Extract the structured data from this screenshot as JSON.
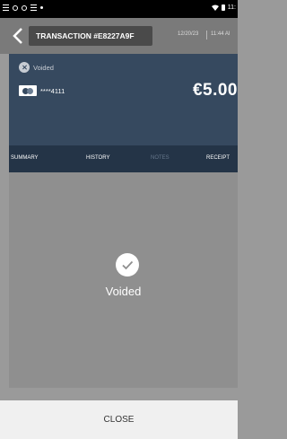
{
  "status_bar": {
    "time": "11:",
    "left_icons": [
      "notification-icon",
      "sync-icon",
      "settings-icon",
      "dot-icon"
    ],
    "right_icons": [
      "wifi-icon",
      "battery-icon"
    ]
  },
  "header": {
    "transaction_title": "TRANSACTION #E8227A9F",
    "date": "12/20/23",
    "time": "11:44 AI"
  },
  "summary": {
    "status": "Voided",
    "card_number": "****4111",
    "card_brand_icon": "mastercard-icon",
    "amount": "€5.00"
  },
  "tabs": [
    {
      "label": "SUMMARY",
      "enabled": true
    },
    {
      "label": "HISTORY",
      "enabled": true
    },
    {
      "label": "NOTES",
      "enabled": false
    },
    {
      "label": "RECEIPT",
      "enabled": true
    }
  ],
  "content": {
    "result_label": "Voided",
    "result_icon": "check-icon"
  },
  "footer": {
    "close_label": "CLOSE"
  },
  "colors": {
    "panel": "#36495f",
    "tab_bar": "#243447",
    "overlay": "#8f8f8f"
  }
}
